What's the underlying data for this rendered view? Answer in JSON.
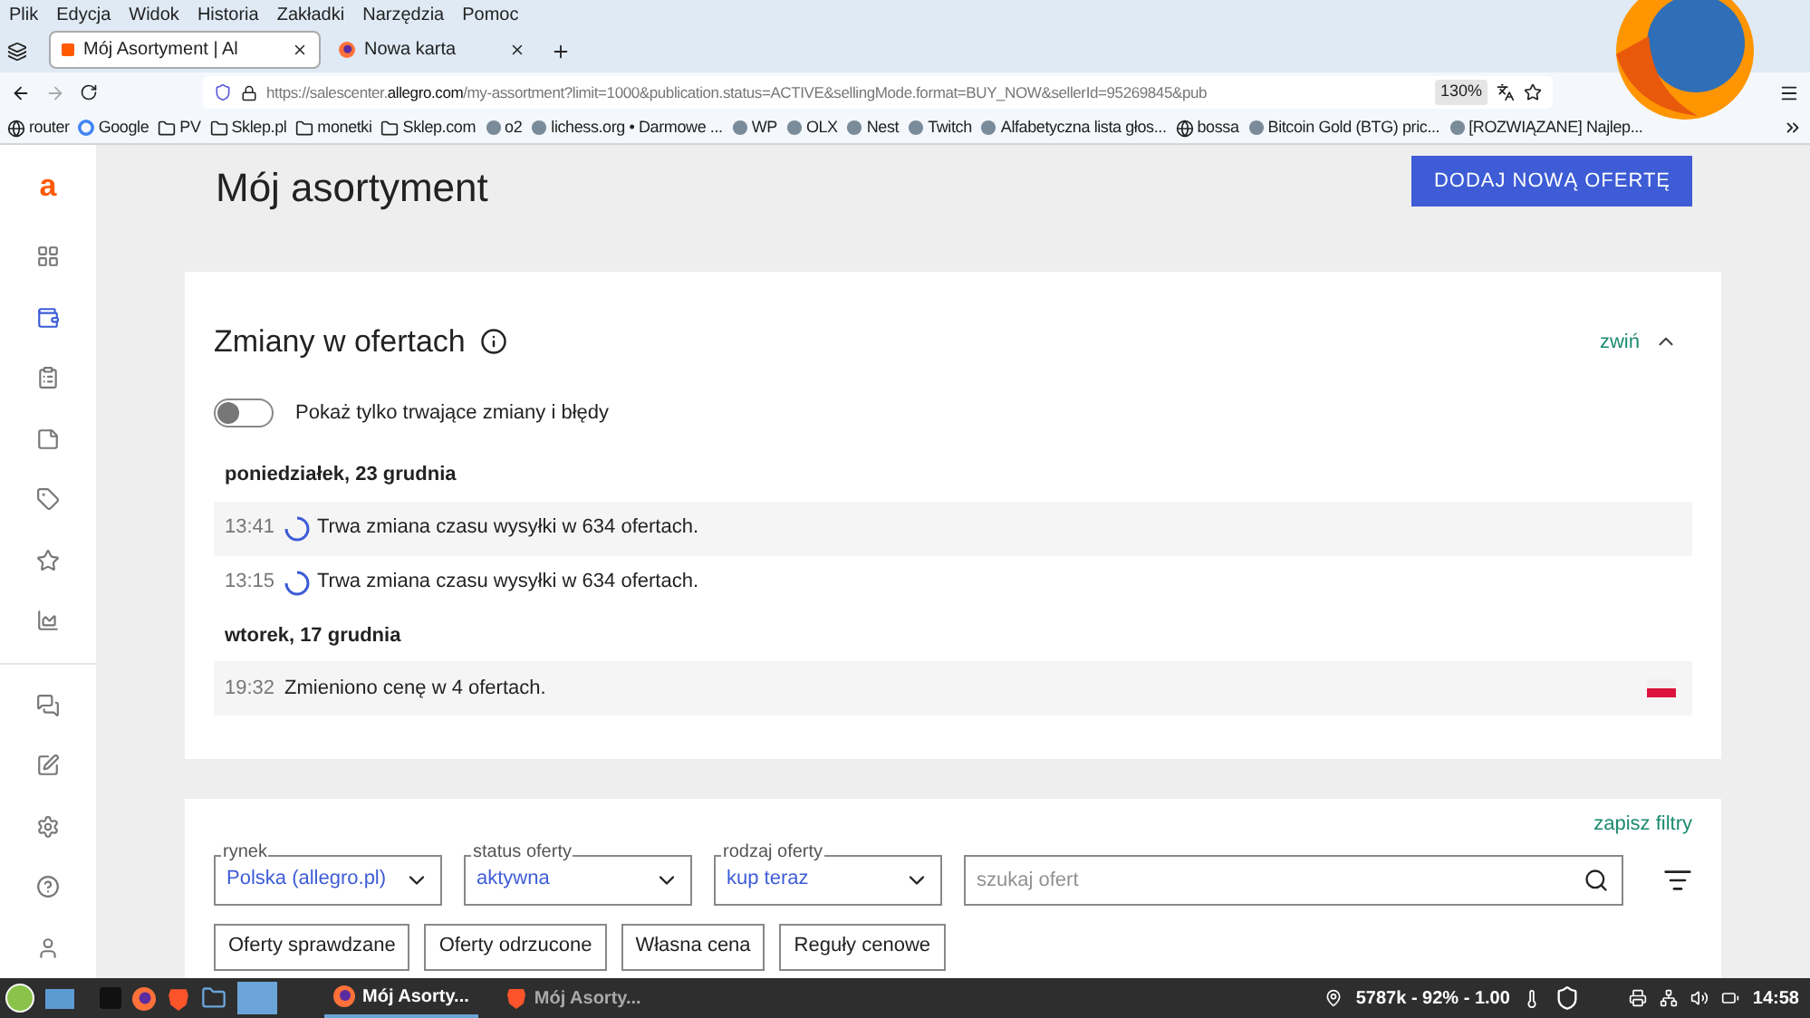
{
  "menu_bar": [
    "Plik",
    "Edycja",
    "Widok",
    "Historia",
    "Zakładki",
    "Narzędzia",
    "Pomoc"
  ],
  "tabs": [
    {
      "label": "Mój Asortyment | Al",
      "selected": true,
      "kind": "allegro"
    },
    {
      "label": "Nowa karta",
      "selected": false,
      "kind": "firefox"
    }
  ],
  "address_bar": {
    "prefix": "https://salescenter.",
    "domain": "allegro.com",
    "rest": "/my-assortment?limit=1000&publication.status=ACTIVE&sellingMode.format=BUY_NOW&sellerId=95269845&pub",
    "zoom": "130%"
  },
  "bookmarks": [
    {
      "label": "router",
      "kind": "globe"
    },
    {
      "label": "Google",
      "kind": "google"
    },
    {
      "label": "PV",
      "kind": "folder"
    },
    {
      "label": "Sklep.pl",
      "kind": "folder"
    },
    {
      "label": "monetki",
      "kind": "folder"
    },
    {
      "label": "Sklep.com",
      "kind": "folder"
    },
    {
      "label": "o2",
      "kind": "site"
    },
    {
      "label": "lichess.org • Darmowe ...",
      "kind": "site"
    },
    {
      "label": "WP",
      "kind": "site"
    },
    {
      "label": "OLX",
      "kind": "site"
    },
    {
      "label": "Nest",
      "kind": "site"
    },
    {
      "label": "Twitch",
      "kind": "site"
    },
    {
      "label": "Alfabetyczna lista głos...",
      "kind": "site"
    },
    {
      "label": "bossa",
      "kind": "globe"
    },
    {
      "label": "Bitcoin Gold (BTG) pric...",
      "kind": "site"
    },
    {
      "label": "[ROZWIĄZANE] Najlep...",
      "kind": "site"
    }
  ],
  "sidebar": {
    "logo": "a",
    "items": [
      {
        "selected": false
      },
      {
        "selected": true
      },
      {
        "selected": false
      },
      {
        "selected": false
      },
      {
        "selected": false
      },
      {
        "selected": false
      },
      {
        "selected": false
      },
      {
        "selected": false
      },
      {
        "selected": false
      },
      {
        "selected": false
      },
      {
        "selected": false
      },
      {
        "selected": false
      }
    ]
  },
  "page": {
    "title": "Mój asortyment",
    "primary_button": "DODAJ NOWĄ OFERTĘ"
  },
  "changes": {
    "title": "Zmiany w ofertach",
    "collapse_link": "zwiń",
    "toggle": {
      "label": "Pokaż tylko trwające zmiany i błędy",
      "on": false
    },
    "days": [
      {
        "date": "poniedziałek, 23 grudnia",
        "entries": [
          {
            "time": "13:41",
            "text": "Trwa zmiana czasu wysyłki w 634 ofertach.",
            "kind": "in_progress",
            "flag": false
          },
          {
            "time": "13:15",
            "text": "Trwa zmiana czasu wysyłki w 634 ofertach.",
            "kind": "in_progress",
            "flag": false
          }
        ]
      },
      {
        "date": "wtorek, 17 grudnia",
        "entries": [
          {
            "time": "19:32",
            "text": "Zmieniono cenę w 4 ofertach.",
            "kind": "done",
            "flag": true
          }
        ]
      }
    ]
  },
  "filters": {
    "save_link": "zapisz filtry",
    "selects": [
      {
        "label": "rynek",
        "value": "Polska (allegro.pl)"
      },
      {
        "label": "status oferty",
        "value": "aktywna"
      },
      {
        "label": "rodzaj oferty",
        "value": "kup teraz"
      }
    ],
    "search": {
      "placeholder": "szukaj ofert"
    },
    "buttons": [
      "Oferty sprawdzane",
      "Oferty odrzucone",
      "Własna cena",
      "Reguły cenowe"
    ]
  },
  "taskbar": {
    "windows": [
      {
        "label": "Mój Asorty...",
        "selected": true,
        "kind": "firefox"
      },
      {
        "label": "Mój Asorty...",
        "selected": false,
        "kind": "brave"
      }
    ],
    "status": "5787k - 92% - 1.00",
    "clock": "14:58"
  }
}
